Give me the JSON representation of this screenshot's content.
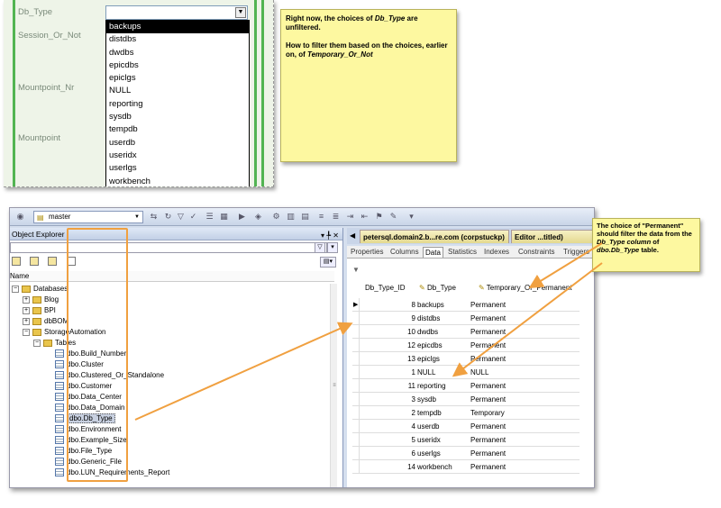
{
  "form": {
    "labels": [
      "Db_Type",
      "Session_Or_Not",
      "Mountpoint_Nr",
      "Mountpoint"
    ],
    "dropdown_items": [
      "backups",
      "distdbs",
      "dwdbs",
      "epicdbs",
      "epiclgs",
      "NULL",
      "reporting",
      "sysdb",
      "tempdb",
      "userdb",
      "useridx",
      "userlgs",
      "workbench"
    ],
    "selected_index": 0
  },
  "note1": {
    "line1_a": "Right now, the choices of ",
    "line1_b": "Db_Type",
    "line1_c": " are unfiltered.",
    "line2_a": "How to filter them based on the choices, earlier on, of ",
    "line2_b": "Temporary_Or_Not"
  },
  "note2": {
    "text_a": "The choice of \"Permanent\" should filter the data from the ",
    "text_b": "Db_Type column",
    "text_c": " of ",
    "text_d": "dbo.Db_Type",
    "text_e": " table."
  },
  "ssms": {
    "db_selector": "master",
    "object_explorer_title": "Object Explorer",
    "object_explorer_ctrl": "▾ ╄ ✕",
    "name_header": "Name",
    "tree": {
      "databases": "Databases",
      "db1": "Blog",
      "db2": "BPI",
      "db3": "dbBOM",
      "db4": "StorageAutomation",
      "tables": "Tables",
      "table_list": [
        "dbo.Build_Number",
        "dbo.Cluster",
        "dbo.Clustered_Or_Standalone",
        "dbo.Customer",
        "dbo.Data_Center",
        "dbo.Data_Domain",
        "dbo.Db_Type",
        "dbo.Environment",
        "dbo.Example_Size",
        "dbo.File_Type",
        "dbo.Generic_File",
        "dbo.LUN_Requirements_Report"
      ]
    },
    "doc_tabs": [
      "petersql.domain2.b...re.com (corpstuckp)",
      "Editor ...titled)"
    ],
    "prop_tabs": [
      "Properties",
      "Columns",
      "Data",
      "Statistics",
      "Indexes",
      "Constraints",
      "Triggers"
    ],
    "active_prop_tab": "Data",
    "grid": {
      "headers": [
        "Db_Type_ID",
        "Db_Type",
        "Temporary_Or_Permanent"
      ],
      "rows": [
        [
          "8",
          "backups",
          "Permanent"
        ],
        [
          "9",
          "distdbs",
          "Permanent"
        ],
        [
          "10",
          "dwdbs",
          "Permanent"
        ],
        [
          "12",
          "epicdbs",
          "Permanent"
        ],
        [
          "13",
          "epiclgs",
          "Permanent"
        ],
        [
          "1",
          "NULL",
          "NULL"
        ],
        [
          "11",
          "reporting",
          "Permanent"
        ],
        [
          "3",
          "sysdb",
          "Permanent"
        ],
        [
          "2",
          "tempdb",
          "Temporary"
        ],
        [
          "4",
          "userdb",
          "Permanent"
        ],
        [
          "5",
          "useridx",
          "Permanent"
        ],
        [
          "6",
          "userlgs",
          "Permanent"
        ],
        [
          "14",
          "workbench",
          "Permanent"
        ]
      ]
    }
  },
  "colors": {
    "accent_green": "#52b452",
    "note_yellow": "#fdf8a0",
    "arrow_orange": "#f0a040"
  }
}
